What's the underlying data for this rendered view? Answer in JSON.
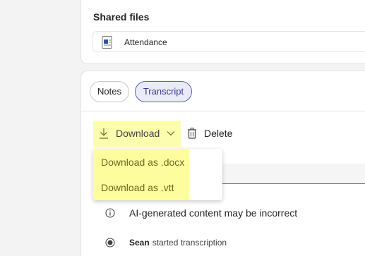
{
  "shared_files": {
    "title": "Shared files",
    "file": {
      "name": "Attendance",
      "icon": "word-document-icon"
    }
  },
  "tabs": [
    {
      "label": "Notes",
      "selected": false
    },
    {
      "label": "Transcript",
      "selected": true
    }
  ],
  "toolbar": {
    "download_label": "Download",
    "delete_label": "Delete"
  },
  "download_menu": {
    "items": [
      {
        "label": "Download as .docx"
      },
      {
        "label": "Download as .vtt"
      }
    ]
  },
  "transcript": {
    "notice": "AI-generated content may be incorrect",
    "event": {
      "user": "Sean",
      "action": "started transcription"
    }
  },
  "colors": {
    "accent": "#5b5fc7",
    "highlight": "#fdfda0",
    "background": "#f3f3f3"
  }
}
